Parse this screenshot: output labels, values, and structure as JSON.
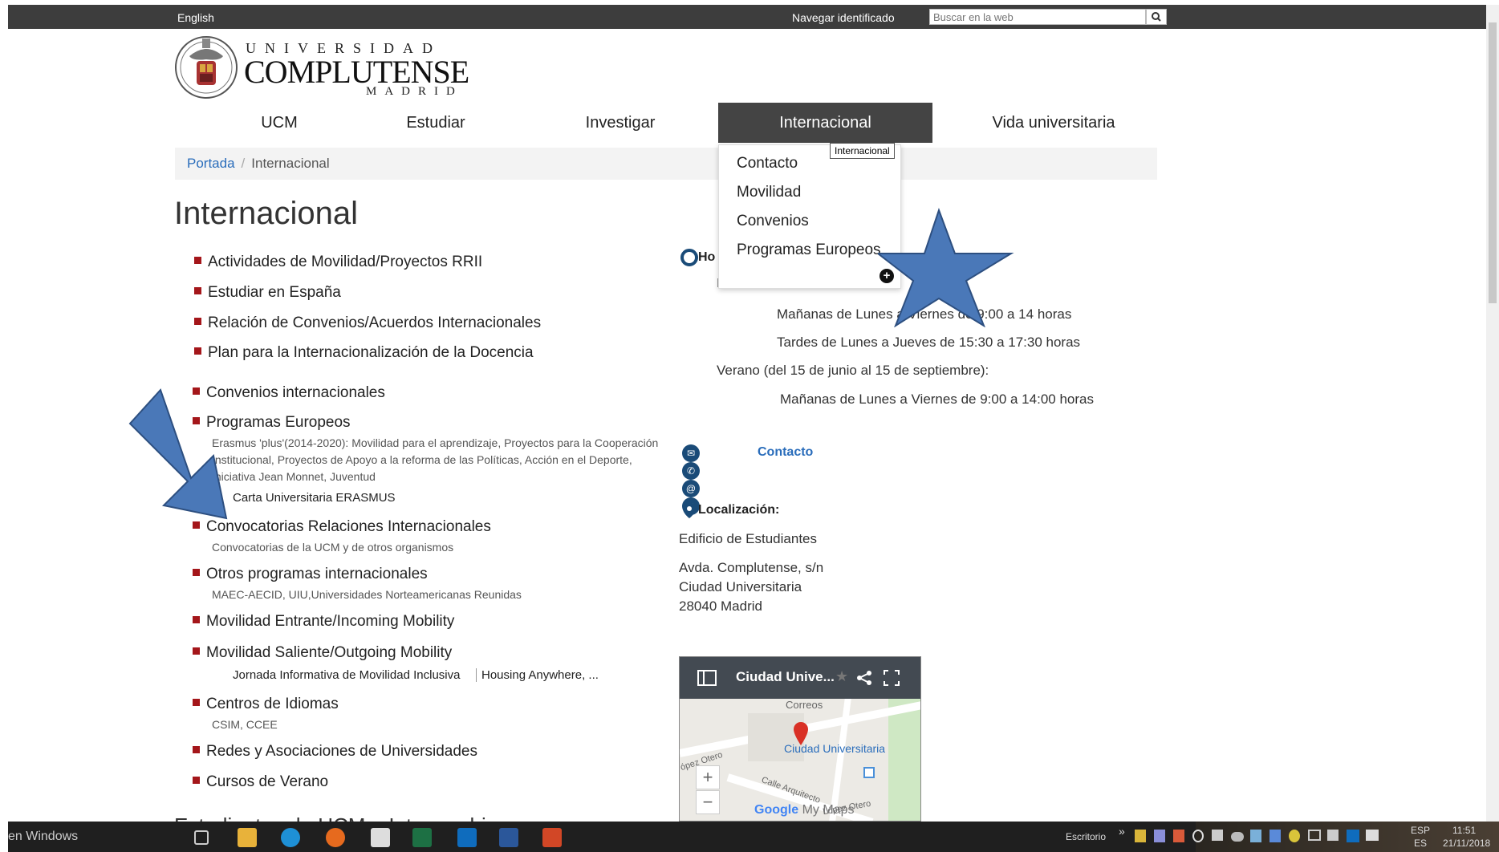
{
  "topbar": {
    "language": "English",
    "login": "Navegar identificado",
    "search_placeholder": "Buscar en la web"
  },
  "logo": {
    "line1": "UNIVERSIDAD",
    "line2": "COMPLUTENSE",
    "line3": "MADRID"
  },
  "nav": {
    "items": [
      {
        "label": "UCM"
      },
      {
        "label": "Estudiar"
      },
      {
        "label": "Investigar"
      },
      {
        "label": "Internacional"
      },
      {
        "label": "Vida universitaria"
      }
    ]
  },
  "breadcrumb": {
    "home": "Portada",
    "separator": "/",
    "current": "Internacional"
  },
  "page_title": "Internacional",
  "left_list": [
    {
      "label": "Actividades de Movilidad/Proyectos RRII"
    },
    {
      "label": "Estudiar en España"
    },
    {
      "label": "Relación de Convenios/Acuerdos Internacionales"
    },
    {
      "label": "Plan para la Internacionalización de la Docencia"
    },
    {
      "label": "Convenios internacionales"
    },
    {
      "label": "Programas Europeos",
      "sub": "Erasmus 'plus'(2014-2020): Movilidad para el aprendizaje, Proyectos para la Cooperación Institucional, Proyectos de Apoyo a la reforma de las Políticas, Acción en el Deporte, Iniciativa Jean Monnet, Juventud",
      "sub2": "Carta Universitaria ERASMUS"
    },
    {
      "label": "Convocatorias Relaciones Internacionales",
      "sub": "Convocatorias de la UCM y de otros organismos"
    },
    {
      "label": "Otros programas internacionales",
      "sub": "MAEC-AECID, UIU,Universidades Norteamericanas Reunidas"
    },
    {
      "label": "Movilidad Entrante/Incoming Mobility"
    },
    {
      "label": "Movilidad Saliente/Outgoing Mobility",
      "sub_a": "Jornada Informativa de Movilidad Inclusiva",
      "sub_b": "Housing Anywhere, ..."
    },
    {
      "label": "Centros de Idiomas",
      "sub": "CSIM, CCEE"
    },
    {
      "label": "Redes y Asociaciones de Universidades"
    },
    {
      "label": "Cursos de Verano"
    }
  ],
  "bottom_partial": "Estudiantes de UCM e Intercambio",
  "right": {
    "horario_partial": "Ho",
    "invierno_partial": "Invierno:",
    "line1": "Mañanas de Lunes a Viernes de 9:00  a 14 horas",
    "line2": "Tardes de Lunes a Jueves de 15:30 a 17:30 horas",
    "verano": "Verano (del 15 de junio al 15 de septiembre):",
    "line3": "Mañanas de Lunes a Viernes de 9:00 a 14:00 horas",
    "contact": "Contacto",
    "loc_title": "Localización:",
    "building": "Edificio de Estudiantes",
    "addr1": "Avda. Complutense, s/n",
    "addr2": "Ciudad Universitaria",
    "addr3": "28040 Madrid"
  },
  "map": {
    "title": "Ciudad Unive...",
    "place": "Ciudad Universitaria",
    "street": "Calle Arquitecto",
    "correos": "Correos",
    "lopez": "López Otero",
    "lopez2": "ópez Otero",
    "zoom_in": "+",
    "zoom_out": "−",
    "google": "Google",
    "mymaps": "My Maps"
  },
  "dropdown": {
    "items": [
      {
        "label": "Contacto"
      },
      {
        "label": "Movilidad"
      },
      {
        "label": "Convenios"
      },
      {
        "label": "Programas Europeos"
      }
    ],
    "tooltip": "Internacional",
    "more": "+"
  },
  "taskbar": {
    "windows_text": "en Windows",
    "escritorio": "Escritorio",
    "chevron": "»",
    "lang_top": "ESP",
    "lang_bottom": "ES",
    "time": "11:51",
    "date": "21/11/2018"
  },
  "colors": {
    "accent_blue": "#2a6dbb",
    "bullet_red": "#a4161a",
    "annotation_blue": "#4a78b8",
    "nav_active": "#444444"
  }
}
